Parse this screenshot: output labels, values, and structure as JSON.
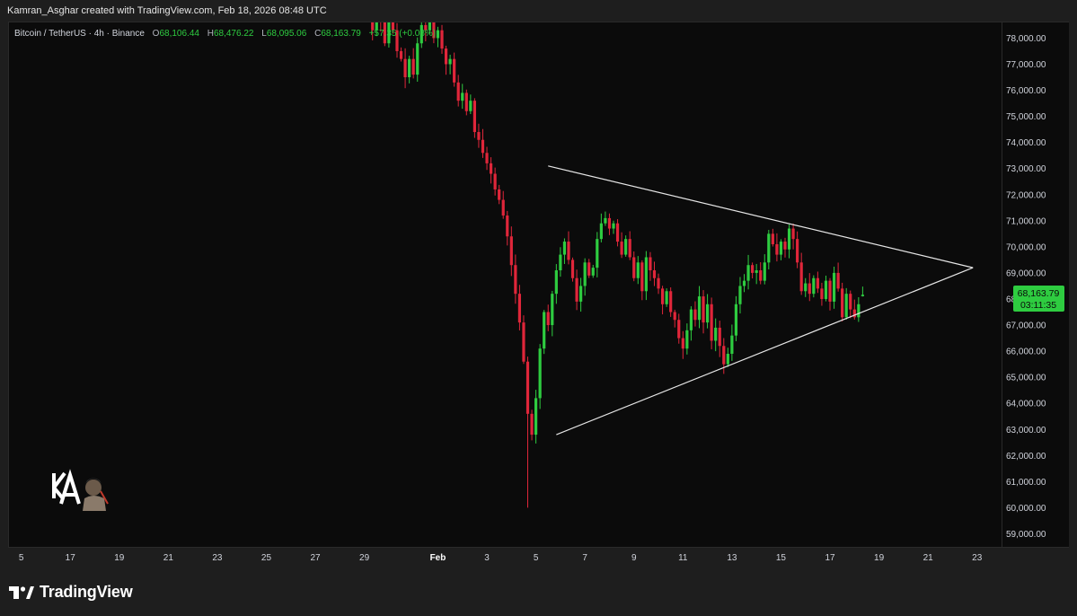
{
  "attribution": "Kamran_Asghar created with TradingView.com, Feb 18, 2026 08:48 UTC",
  "legend": {
    "symbol": "Bitcoin / TetherUS · 4h · Binance",
    "open_label": "O",
    "open": "68,106.44",
    "high_label": "H",
    "high": "68,476.22",
    "low_label": "L",
    "low": "68,095.06",
    "close_label": "C",
    "close": "68,163.79",
    "change": "+57.35 (+0.08%)"
  },
  "last_price": {
    "price": "68,163.79",
    "countdown": "03:11:35"
  },
  "branding": {
    "logo_text": "TradingView"
  },
  "colors": {
    "up": "#2ecc40",
    "down": "#e0263a",
    "background": "#0b0b0b",
    "trendline": "#e6e6e6",
    "price_tag": "#2ecc40"
  },
  "chart_data": {
    "type": "candlestick",
    "symbol": "BTCUSDT",
    "interval": "4h",
    "exchange": "Binance",
    "ylim": [
      58500,
      78600
    ],
    "y_ticks": [
      59000,
      60000,
      61000,
      62000,
      63000,
      64000,
      65000,
      66000,
      67000,
      68000,
      69000,
      70000,
      71000,
      72000,
      73000,
      74000,
      75000,
      76000,
      77000,
      78000
    ],
    "y_tick_labels": [
      "59,000.00",
      "60,000.00",
      "61,000.00",
      "62,000.00",
      "63,000.00",
      "64,000.00",
      "65,000.00",
      "66,000.00",
      "67,000.00",
      "68,000.00",
      "69,000.00",
      "70,000.00",
      "71,000.00",
      "72,000.00",
      "73,000.00",
      "74,000.00",
      "75,000.00",
      "76,000.00",
      "77,000.00",
      "78,000.00"
    ],
    "x_domain": [
      "Jan 14 12:00",
      "Feb 24 00:00"
    ],
    "x_ticks": [
      {
        "date": "Jan 15",
        "label": "5"
      },
      {
        "date": "Jan 17",
        "label": "17"
      },
      {
        "date": "Jan 19",
        "label": "19"
      },
      {
        "date": "Jan 21",
        "label": "21"
      },
      {
        "date": "Jan 23",
        "label": "23"
      },
      {
        "date": "Jan 25",
        "label": "25"
      },
      {
        "date": "Jan 27",
        "label": "27"
      },
      {
        "date": "Jan 29",
        "label": "29"
      },
      {
        "date": "Feb 1",
        "label": "Feb"
      },
      {
        "date": "Feb 3",
        "label": "3"
      },
      {
        "date": "Feb 5",
        "label": "5"
      },
      {
        "date": "Feb 7",
        "label": "7"
      },
      {
        "date": "Feb 9",
        "label": "9"
      },
      {
        "date": "Feb 11",
        "label": "11"
      },
      {
        "date": "Feb 13",
        "label": "13"
      },
      {
        "date": "Feb 15",
        "label": "15"
      },
      {
        "date": "Feb 17",
        "label": "17"
      },
      {
        "date": "Feb 19",
        "label": "19"
      },
      {
        "date": "Feb 21",
        "label": "21"
      },
      {
        "date": "Feb 23",
        "label": "23"
      }
    ],
    "closes": [
      79500,
      78900,
      79300,
      78300,
      78900,
      78600,
      77800,
      78900,
      78300,
      77500,
      77200,
      76500,
      77200,
      76600,
      77800,
      78500,
      78300,
      78800,
      78000,
      78300,
      77600,
      77000,
      77200,
      76300,
      75600,
      75900,
      75200,
      75600,
      74400,
      74100,
      73600,
      73200,
      72800,
      72200,
      71800,
      71200,
      70400,
      69300,
      68200,
      67100,
      65600,
      63600,
      62800,
      64200,
      66100,
      67500,
      67000,
      68200,
      69100,
      69700,
      70200,
      69500,
      68800,
      67900,
      68500,
      69400,
      68900,
      69200,
      70300,
      70900,
      71100,
      70700,
      70900,
      70200,
      69700,
      70300,
      69600,
      68800,
      69400,
      68300,
      69600,
      69100,
      68800,
      68400,
      67800,
      68300,
      67500,
      67200,
      66500,
      66100,
      66800,
      67600,
      67200,
      68100,
      67100,
      67800,
      66400,
      66900,
      66200,
      65500,
      65900,
      66600,
      67800,
      68500,
      68700,
      69300,
      69000,
      69100,
      68700,
      69400,
      70500,
      70100,
      69700,
      70200,
      69900,
      70700,
      70300,
      69400,
      68300,
      68600,
      68200,
      68800,
      68400,
      68000,
      68700,
      67900,
      69000,
      68400,
      67300,
      68200,
      67600,
      67300,
      67800,
      68163.79
    ],
    "triangle": {
      "upper_line": [
        {
          "date": "Feb 5 12:00",
          "price": 73100
        },
        {
          "date": "Feb 22 20:00",
          "price": 69200
        }
      ],
      "lower_line": [
        {
          "date": "Feb 5 20:00",
          "price": 62800
        },
        {
          "date": "Feb 22 20:00",
          "price": 69200
        }
      ]
    }
  }
}
